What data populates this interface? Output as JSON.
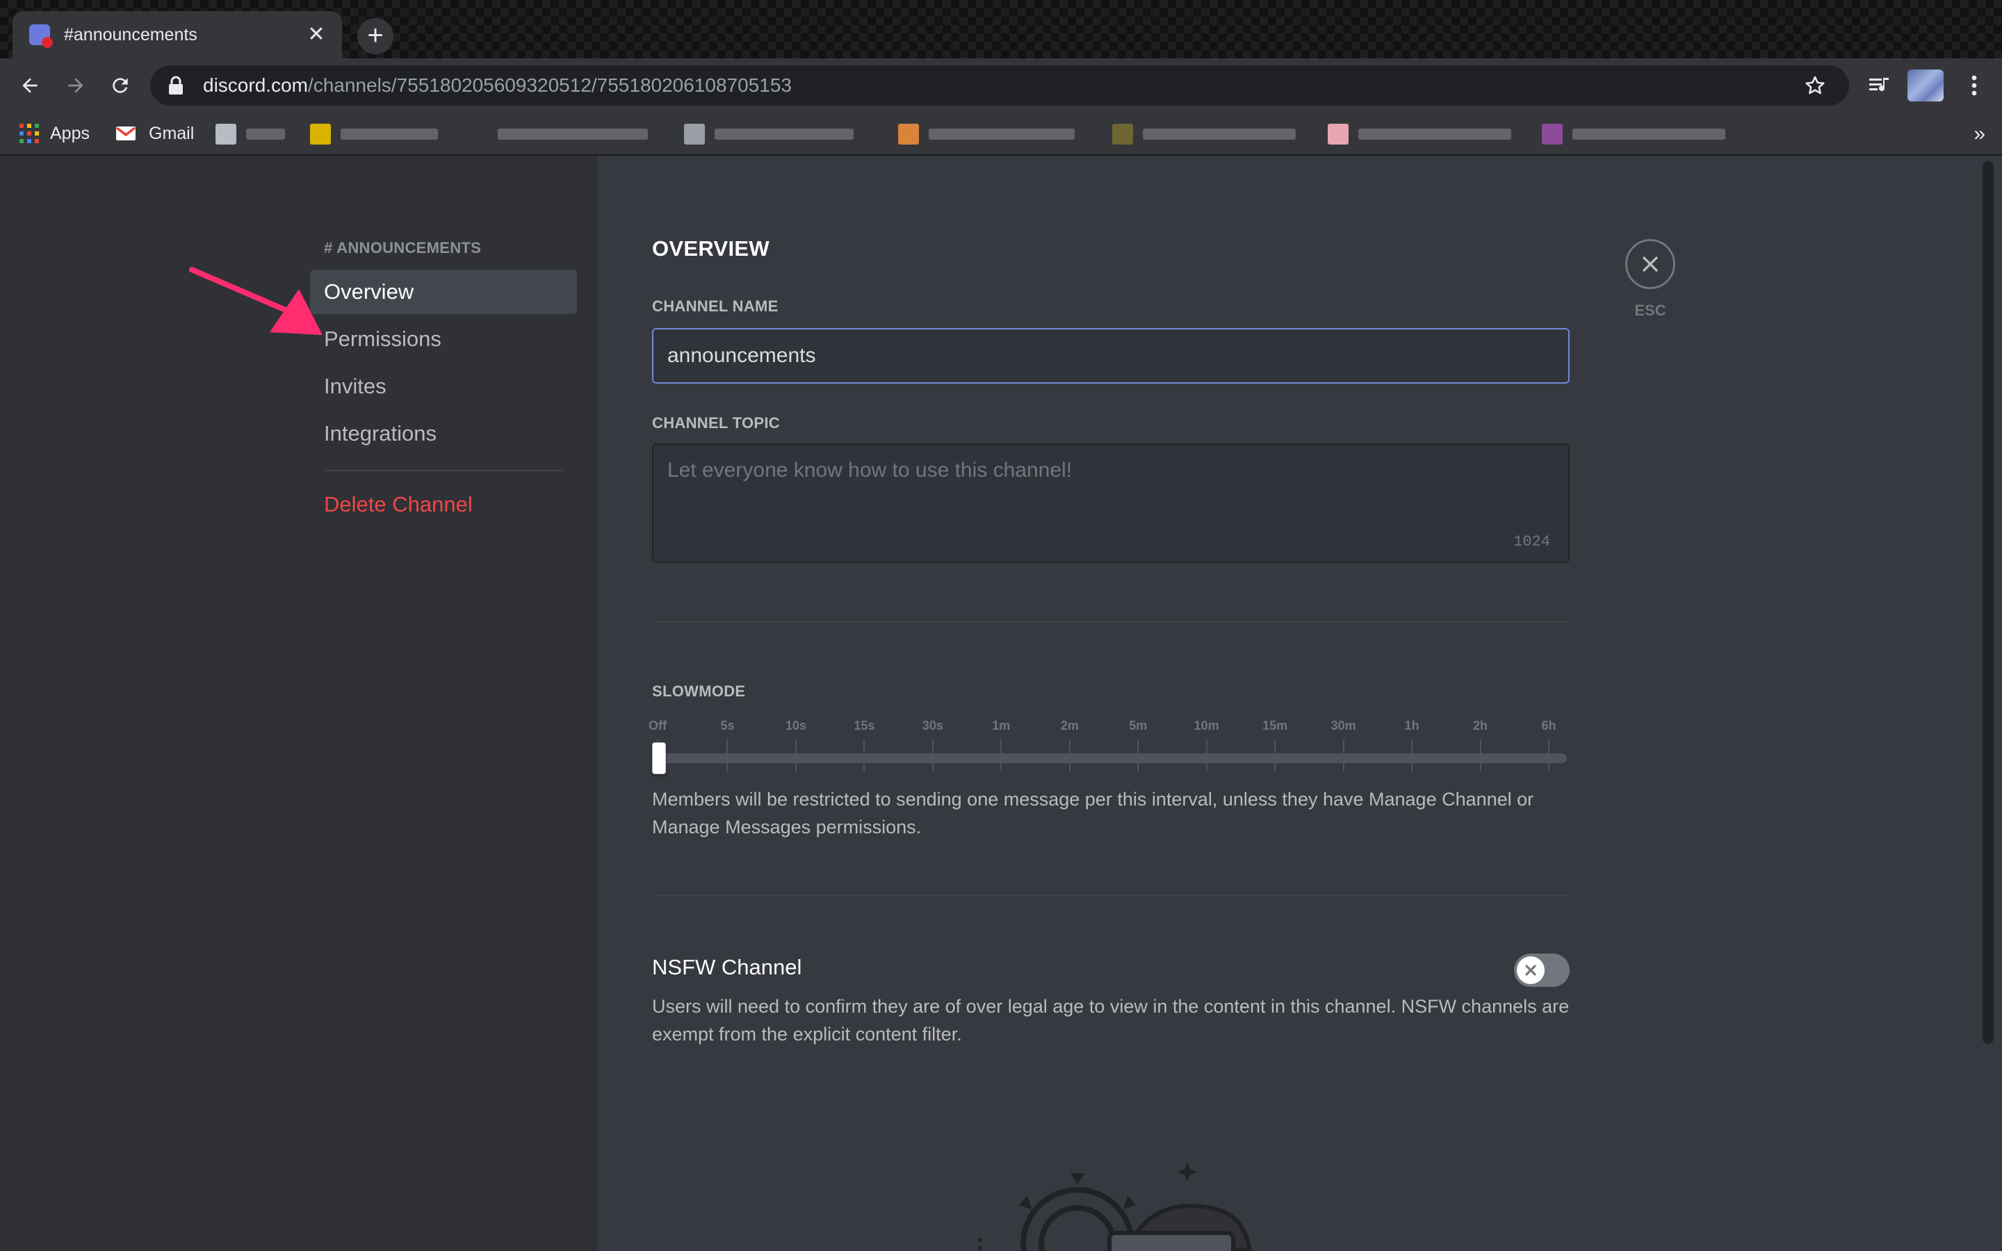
{
  "browser": {
    "tab_title": "#announcements",
    "tab_close": "✕",
    "new_tab": "+",
    "url_host": "discord.com",
    "url_path": "/channels/755180205609320512/755180206108705153",
    "bookmarks": [
      {
        "label": "Apps",
        "icon": "apps-grid-icon"
      },
      {
        "label": "Gmail",
        "icon": "gmail-icon"
      }
    ],
    "bookmarks_overflow": "»",
    "icons": [
      "back-arrow-icon",
      "forward-arrow-icon",
      "reload-icon",
      "lock-icon",
      "star-icon",
      "media-controls-icon",
      "profile-avatar-icon",
      "kebab-menu-icon"
    ]
  },
  "sidebar": {
    "header": "# ANNOUNCEMENTS",
    "items": [
      {
        "label": "Overview",
        "active": true
      },
      {
        "label": "Permissions"
      },
      {
        "label": "Invites"
      },
      {
        "label": "Integrations"
      }
    ],
    "danger_item": "Delete Channel"
  },
  "main": {
    "title": "OVERVIEW",
    "channel_name_label": "CHANNEL NAME",
    "channel_name_value": "announcements",
    "channel_topic_label": "CHANNEL TOPIC",
    "channel_topic_placeholder": "Let everyone know how to use this channel!",
    "channel_topic_counter": "1024",
    "slowmode_label": "SLOWMODE",
    "slowmode_ticks": [
      "Off",
      "5s",
      "10s",
      "15s",
      "30s",
      "1m",
      "2m",
      "5m",
      "10m",
      "15m",
      "30m",
      "1h",
      "2h",
      "6h"
    ],
    "slowmode_selected": "Off",
    "slowmode_desc": "Members will be restricted to sending one message per this interval, unless they have Manage Channel or Manage Messages permissions.",
    "nsfw_title": "NSFW Channel",
    "nsfw_enabled": false,
    "nsfw_desc": "Users will need to confirm they are of over legal age to view in the content in this channel. NSFW channels are exempt from the explicit content filter."
  },
  "close": {
    "icon": "close-icon",
    "label": "ESC"
  },
  "colors": {
    "blurple": "#7289da",
    "danger": "#f04747",
    "annotation_arrow": "#ff2d6f"
  }
}
